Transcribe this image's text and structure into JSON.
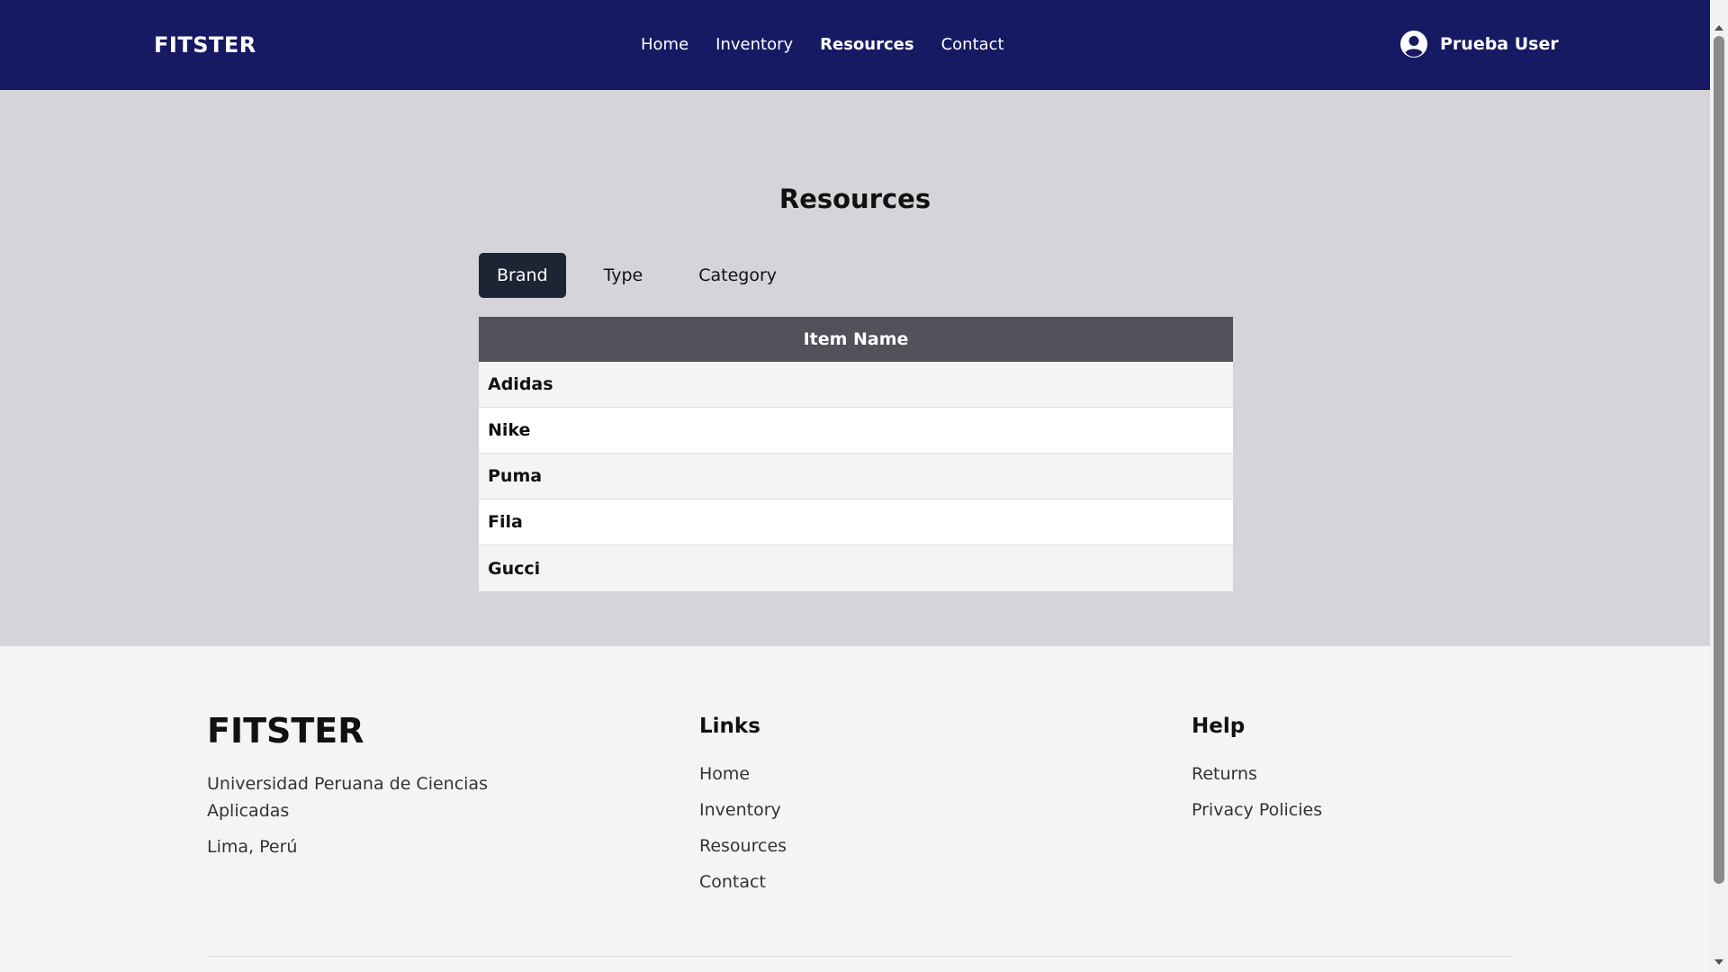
{
  "header": {
    "brand": "FITSTER",
    "nav": [
      {
        "label": "Home"
      },
      {
        "label": "Inventory"
      },
      {
        "label": "Resources"
      },
      {
        "label": "Contact"
      }
    ],
    "active_nav": "Resources",
    "user_name": "Prueba User"
  },
  "main": {
    "title": "Resources",
    "tabs": [
      {
        "label": "Brand"
      },
      {
        "label": "Type"
      },
      {
        "label": "Category"
      }
    ],
    "active_tab": "Brand",
    "table": {
      "header": "Item Name",
      "rows": [
        "Adidas",
        "Nike",
        "Puma",
        "Fila",
        "Gucci"
      ]
    }
  },
  "footer": {
    "brand": "FITSTER",
    "address_line1": "Universidad Peruana de Ciencias Aplicadas",
    "address_line2": "Lima, Perú",
    "links_heading": "Links",
    "links": [
      "Home",
      "Inventory",
      "Resources",
      "Contact"
    ],
    "help_heading": "Help",
    "help_links": [
      "Returns",
      "Privacy Policies"
    ]
  },
  "colors": {
    "navbar": "#161a63",
    "main_bg": "#d4d4da",
    "active_tab": "#1d2535",
    "table_header": "#505159",
    "footer_bg": "#f3f4f6"
  }
}
